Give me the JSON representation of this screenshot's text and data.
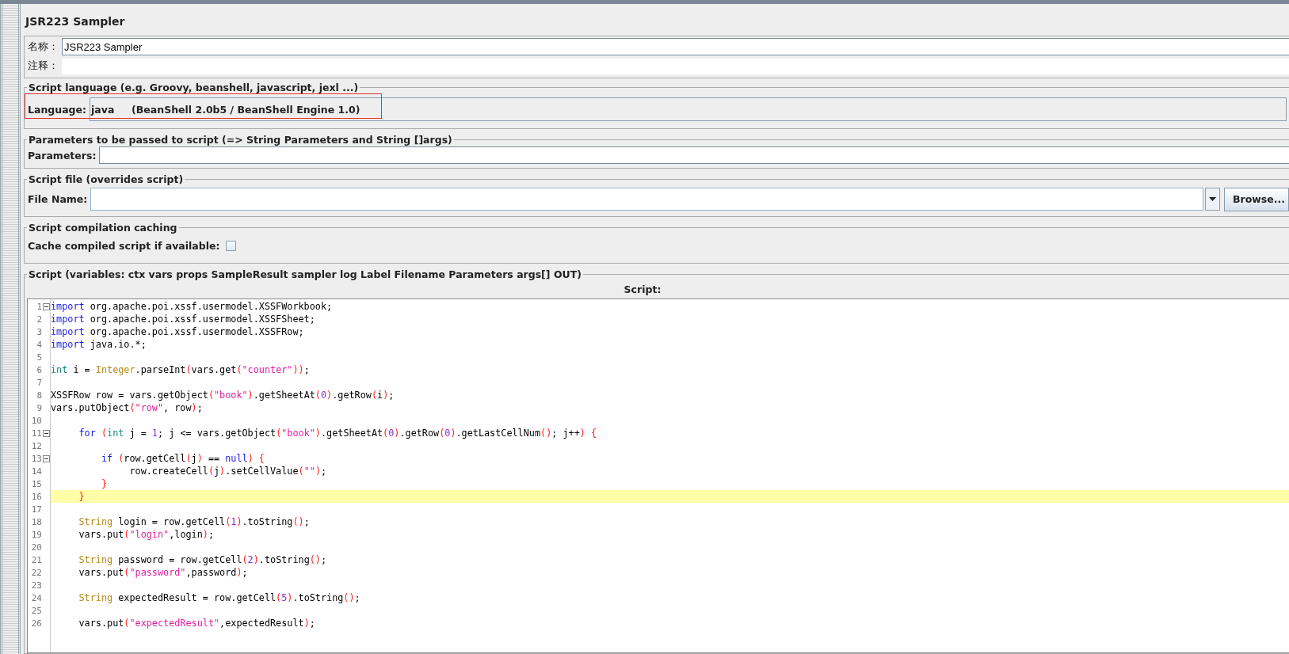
{
  "title": "JSR223 Sampler",
  "name": {
    "label": "名称：",
    "value": "JSR223 Sampler"
  },
  "comment": {
    "label": "注释："
  },
  "script_language": {
    "legend": "Script language (e.g. Groovy, beanshell, javascript, jexl ...)",
    "label": "Language:",
    "value": "java     (BeanShell 2.0b5 / BeanShell Engine 1.0)"
  },
  "parameters": {
    "legend": "Parameters to be passed to script (=> String Parameters and String []args)",
    "label": "Parameters:"
  },
  "script_file": {
    "legend": "Script file (overrides script)",
    "label": "File Name:",
    "button": "Browse..."
  },
  "caching": {
    "legend": "Script compilation caching",
    "label": "Cache compiled script if available:",
    "checked": false
  },
  "script": {
    "legend": "Script (variables: ctx vars props SampleResult sampler log Label Filename Parameters args[] OUT)",
    "label": "Script:",
    "lines": [
      {
        "number": "1",
        "foldable": true,
        "highlighted": false,
        "tokens": [
          {
            "kind": "keyword",
            "text": "import"
          },
          {
            "kind": "plain",
            "text": " org.apache.poi.xssf.usermodel.XSSFWorkbook;"
          }
        ]
      },
      {
        "number": "2",
        "foldable": false,
        "highlighted": false,
        "tokens": [
          {
            "kind": "keyword",
            "text": "import"
          },
          {
            "kind": "plain",
            "text": " org.apache.poi.xssf.usermodel.XSSFSheet;"
          }
        ]
      },
      {
        "number": "3",
        "foldable": false,
        "highlighted": false,
        "tokens": [
          {
            "kind": "keyword",
            "text": "import"
          },
          {
            "kind": "plain",
            "text": " org.apache.poi.xssf.usermodel.XSSFRow;"
          }
        ]
      },
      {
        "number": "4",
        "foldable": false,
        "highlighted": false,
        "tokens": [
          {
            "kind": "keyword",
            "text": "import"
          },
          {
            "kind": "plain",
            "text": " java.io.*;"
          }
        ]
      },
      {
        "number": "5",
        "foldable": false,
        "highlighted": false
      },
      {
        "number": "6",
        "foldable": false,
        "highlighted": false,
        "tokens": [
          {
            "kind": "type",
            "text": "int"
          },
          {
            "kind": "plain",
            "text": " i = "
          },
          {
            "kind": "class",
            "text": "Integer"
          },
          {
            "kind": "plain",
            "text": ".parseInt"
          },
          {
            "kind": "paren",
            "text": "("
          },
          {
            "kind": "plain",
            "text": "vars.get"
          },
          {
            "kind": "paren",
            "text": "("
          },
          {
            "kind": "string",
            "text": "\"counter\""
          },
          {
            "kind": "paren",
            "text": "))"
          },
          {
            "kind": "plain",
            "text": ";"
          }
        ]
      },
      {
        "number": "7",
        "foldable": false,
        "highlighted": false
      },
      {
        "number": "8",
        "foldable": false,
        "highlighted": false,
        "tokens": [
          {
            "kind": "plain",
            "text": "XSSFRow row = vars.getObject"
          },
          {
            "kind": "paren",
            "text": "("
          },
          {
            "kind": "string",
            "text": "\"book\""
          },
          {
            "kind": "paren",
            "text": ")"
          },
          {
            "kind": "plain",
            "text": ".getSheetAt"
          },
          {
            "kind": "paren",
            "text": "("
          },
          {
            "kind": "number",
            "text": "0"
          },
          {
            "kind": "paren",
            "text": ")"
          },
          {
            "kind": "plain",
            "text": ".getRow"
          },
          {
            "kind": "paren",
            "text": "("
          },
          {
            "kind": "plain",
            "text": "i"
          },
          {
            "kind": "paren",
            "text": ")"
          },
          {
            "kind": "plain",
            "text": ";"
          }
        ]
      },
      {
        "number": "9",
        "foldable": false,
        "highlighted": false,
        "tokens": [
          {
            "kind": "plain",
            "text": "vars.putObject"
          },
          {
            "kind": "paren",
            "text": "("
          },
          {
            "kind": "string",
            "text": "\"row\""
          },
          {
            "kind": "plain",
            "text": ", row"
          },
          {
            "kind": "paren",
            "text": ")"
          },
          {
            "kind": "plain",
            "text": ";"
          }
        ]
      },
      {
        "number": "10",
        "foldable": false,
        "highlighted": false
      },
      {
        "number": "11",
        "foldable": true,
        "highlighted": false,
        "tokens": [
          {
            "kind": "keyword",
            "text": "     for "
          },
          {
            "kind": "paren",
            "text": "("
          },
          {
            "kind": "type",
            "text": "int"
          },
          {
            "kind": "plain",
            "text": " j = "
          },
          {
            "kind": "number",
            "text": "1"
          },
          {
            "kind": "plain",
            "text": "; j <= vars.getObject"
          },
          {
            "kind": "paren",
            "text": "("
          },
          {
            "kind": "string",
            "text": "\"book\""
          },
          {
            "kind": "paren",
            "text": ")"
          },
          {
            "kind": "plain",
            "text": ".getSheetAt"
          },
          {
            "kind": "paren",
            "text": "("
          },
          {
            "kind": "number",
            "text": "0"
          },
          {
            "kind": "paren",
            "text": ")"
          },
          {
            "kind": "plain",
            "text": ".getRow"
          },
          {
            "kind": "paren",
            "text": "("
          },
          {
            "kind": "number",
            "text": "0"
          },
          {
            "kind": "paren",
            "text": ")"
          },
          {
            "kind": "plain",
            "text": ".getLastCellNum"
          },
          {
            "kind": "paren",
            "text": "()"
          },
          {
            "kind": "plain",
            "text": "; j++"
          },
          {
            "kind": "paren",
            "text": ") {"
          }
        ]
      },
      {
        "number": "12",
        "foldable": false,
        "highlighted": false
      },
      {
        "number": "13",
        "foldable": true,
        "highlighted": false,
        "tokens": [
          {
            "kind": "keyword",
            "text": "         if "
          },
          {
            "kind": "paren",
            "text": "("
          },
          {
            "kind": "plain",
            "text": "row.getCell"
          },
          {
            "kind": "paren",
            "text": "("
          },
          {
            "kind": "plain",
            "text": "j"
          },
          {
            "kind": "paren",
            "text": ")"
          },
          {
            "kind": "plain",
            "text": " == "
          },
          {
            "kind": "keyword",
            "text": "null"
          },
          {
            "kind": "paren",
            "text": ") {"
          }
        ]
      },
      {
        "number": "14",
        "foldable": false,
        "highlighted": false,
        "tokens": [
          {
            "kind": "plain",
            "text": "              row.createCell"
          },
          {
            "kind": "paren",
            "text": "("
          },
          {
            "kind": "plain",
            "text": "j"
          },
          {
            "kind": "paren",
            "text": ")"
          },
          {
            "kind": "plain",
            "text": ".setCellValue"
          },
          {
            "kind": "paren",
            "text": "("
          },
          {
            "kind": "string",
            "text": "\"\""
          },
          {
            "kind": "paren",
            "text": ")"
          },
          {
            "kind": "plain",
            "text": ";"
          }
        ]
      },
      {
        "number": "15",
        "foldable": false,
        "highlighted": false,
        "tokens": [
          {
            "kind": "paren",
            "text": "         }"
          }
        ]
      },
      {
        "number": "16",
        "foldable": false,
        "highlighted": true,
        "tokens": [
          {
            "kind": "paren",
            "text": "     }"
          }
        ]
      },
      {
        "number": "17",
        "foldable": false,
        "highlighted": false
      },
      {
        "number": "18",
        "foldable": false,
        "highlighted": false,
        "tokens": [
          {
            "kind": "class",
            "text": "     String"
          },
          {
            "kind": "plain",
            "text": " login = row.getCell"
          },
          {
            "kind": "paren",
            "text": "("
          },
          {
            "kind": "number",
            "text": "1"
          },
          {
            "kind": "paren",
            "text": ")"
          },
          {
            "kind": "plain",
            "text": ".toString"
          },
          {
            "kind": "paren",
            "text": "()"
          },
          {
            "kind": "plain",
            "text": ";"
          }
        ]
      },
      {
        "number": "19",
        "foldable": false,
        "highlighted": false,
        "tokens": [
          {
            "kind": "plain",
            "text": "     vars.put"
          },
          {
            "kind": "paren",
            "text": "("
          },
          {
            "kind": "string",
            "text": "\"login\""
          },
          {
            "kind": "plain",
            "text": ",login"
          },
          {
            "kind": "paren",
            "text": ")"
          },
          {
            "kind": "plain",
            "text": ";"
          }
        ]
      },
      {
        "number": "20",
        "foldable": false,
        "highlighted": false
      },
      {
        "number": "21",
        "foldable": false,
        "highlighted": false,
        "tokens": [
          {
            "kind": "class",
            "text": "     String"
          },
          {
            "kind": "plain",
            "text": " password = row.getCell"
          },
          {
            "kind": "paren",
            "text": "("
          },
          {
            "kind": "number",
            "text": "2"
          },
          {
            "kind": "paren",
            "text": ")"
          },
          {
            "kind": "plain",
            "text": ".toString"
          },
          {
            "kind": "paren",
            "text": "()"
          },
          {
            "kind": "plain",
            "text": ";"
          }
        ]
      },
      {
        "number": "22",
        "foldable": false,
        "highlighted": false,
        "tokens": [
          {
            "kind": "plain",
            "text": "     vars.put"
          },
          {
            "kind": "paren",
            "text": "("
          },
          {
            "kind": "string",
            "text": "\"password\""
          },
          {
            "kind": "plain",
            "text": ",password"
          },
          {
            "kind": "paren",
            "text": ")"
          },
          {
            "kind": "plain",
            "text": ";"
          }
        ]
      },
      {
        "number": "23",
        "foldable": false,
        "highlighted": false
      },
      {
        "number": "24",
        "foldable": false,
        "highlighted": false,
        "tokens": [
          {
            "kind": "class",
            "text": "     String"
          },
          {
            "kind": "plain",
            "text": " expectedResult = row.getCell"
          },
          {
            "kind": "paren",
            "text": "("
          },
          {
            "kind": "number",
            "text": "5"
          },
          {
            "kind": "paren",
            "text": ")"
          },
          {
            "kind": "plain",
            "text": ".toString"
          },
          {
            "kind": "paren",
            "text": "()"
          },
          {
            "kind": "plain",
            "text": ";"
          }
        ]
      },
      {
        "number": "25",
        "foldable": false,
        "highlighted": false
      },
      {
        "number": "26",
        "foldable": false,
        "highlighted": false,
        "tokens": [
          {
            "kind": "plain",
            "text": "     vars.put"
          },
          {
            "kind": "paren",
            "text": "("
          },
          {
            "kind": "string",
            "text": "\"expectedResult\""
          },
          {
            "kind": "plain",
            "text": ",expectedResult"
          },
          {
            "kind": "paren",
            "text": ")"
          },
          {
            "kind": "plain",
            "text": ";"
          }
        ]
      }
    ]
  }
}
